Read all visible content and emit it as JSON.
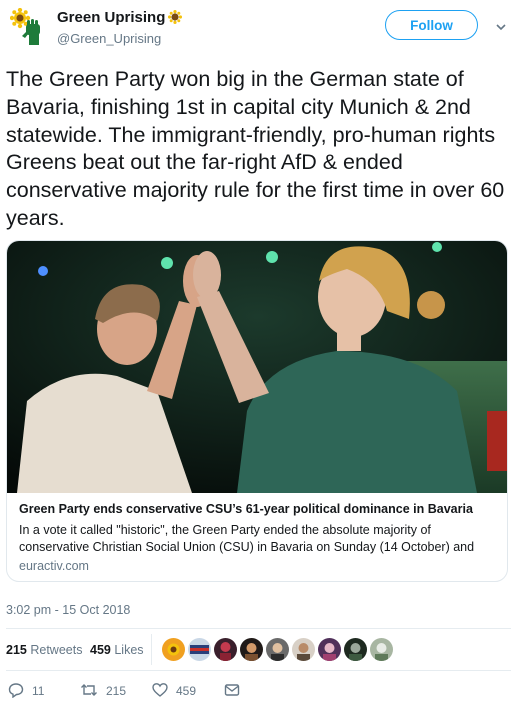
{
  "account": {
    "display_name": "Green Uprising",
    "name_emoji_icon": "sunflower-icon",
    "handle": "@Green_Uprising",
    "avatar_icon": "raised-fist-sunflower-avatar-icon"
  },
  "follow_button": {
    "label": "Follow"
  },
  "tweet": {
    "text": "The Green Party won big in the German state of Bavaria, finishing 1st in capital city Munich & 2nd statewide. The immigrant-friendly, pro-human rights Greens beat out the far-right AfD & ended conservative majority rule for the first time in over 60 years.",
    "timestamp": "3:02 pm - 15 Oct 2018"
  },
  "card": {
    "title": "Green Party ends conservative CSU’s 61-year political dominance in Bavaria",
    "description": "In a vote it called \"historic\", the Green Party ended the absolute majority of conservative Christian Social Union (CSU) in Bavaria on Sunday (14 October) and",
    "domain": "euractiv.com"
  },
  "stats": {
    "retweets_count": "215",
    "retweets_label": "Retweets",
    "likes_count": "459",
    "likes_label": "Likes"
  },
  "actions": {
    "reply_count": "11",
    "retweet_count": "215",
    "like_count": "459"
  },
  "colors": {
    "accent": "#1da1f2",
    "secondary_text": "#657786",
    "divider": "#e6ecf0"
  }
}
